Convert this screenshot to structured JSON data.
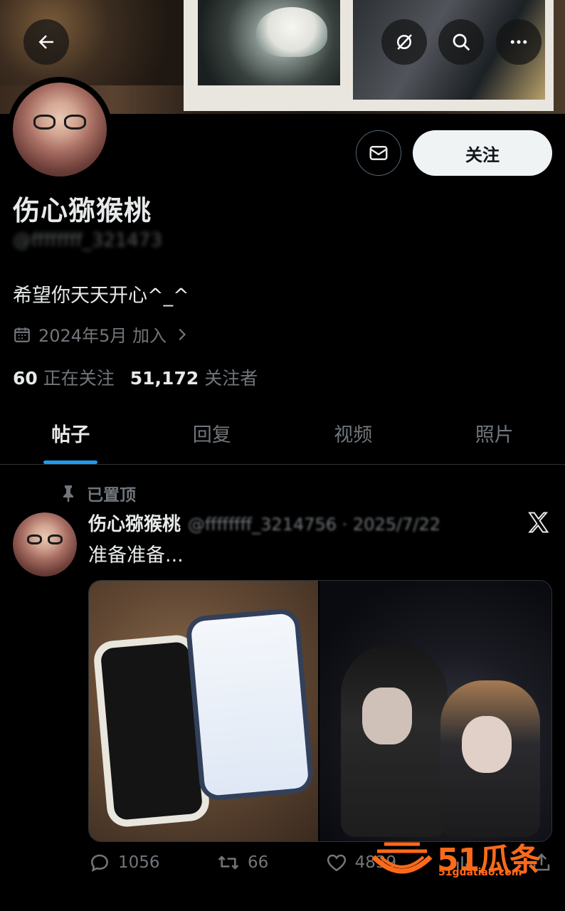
{
  "profile": {
    "name": "伤心猕猴桃",
    "handle": "@ffffffff_321473",
    "bio": "希望你天天开心^_^",
    "joined": "2024年5月 加入",
    "following_count": "60",
    "following_label": "正在关注",
    "followers_count": "51,172",
    "followers_label": "关注者",
    "follow_label": "关注"
  },
  "tabs": [
    {
      "label": "帖子"
    },
    {
      "label": "回复"
    },
    {
      "label": "视频"
    },
    {
      "label": "照片"
    }
  ],
  "post": {
    "pinned_label": "已置顶",
    "author_name": "伤心猕猴桃",
    "author_meta": "@ffffffff_3214756 · 2025/7/22",
    "text": "准备准备...",
    "replies": "1056",
    "reposts": "66",
    "likes": "4839"
  },
  "watermark": {
    "brand": "51瓜条",
    "site": "51guatiao.com"
  },
  "colors": {
    "accent": "#1d9bf0",
    "muted": "#71767b",
    "text": "#e7e9ea",
    "watermark": "#ff6a1a"
  }
}
